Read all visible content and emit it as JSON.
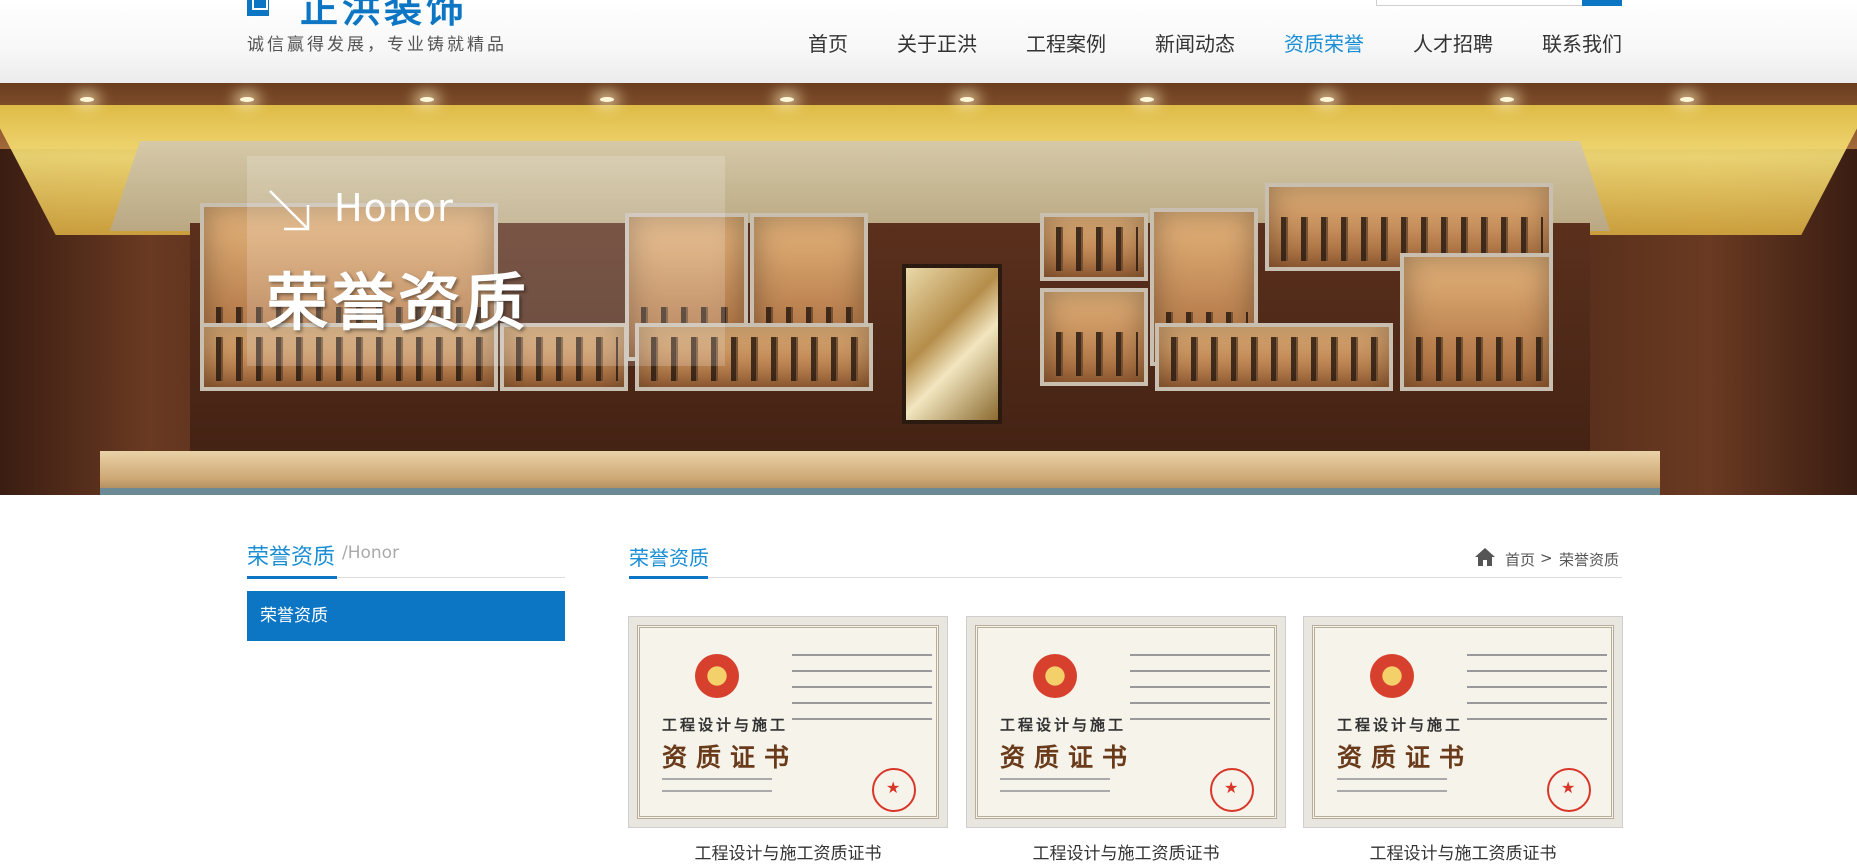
{
  "header": {
    "logo_name": "正洪装饰",
    "slogan": "诚信赢得发展，专业铸就精品"
  },
  "nav": {
    "items": [
      {
        "label": "首页"
      },
      {
        "label": "关于正洪"
      },
      {
        "label": "工程案例"
      },
      {
        "label": "新闻动态"
      },
      {
        "label": "资质荣誉"
      },
      {
        "label": "人才招聘"
      },
      {
        "label": "联系我们"
      }
    ],
    "active_index": 4
  },
  "banner": {
    "en": "Honor",
    "cn": "荣誉资质"
  },
  "sidebar": {
    "title": "荣誉资质",
    "subtitle": "/Honor",
    "items": [
      {
        "label": "荣誉资质"
      }
    ]
  },
  "main": {
    "title": "荣誉资质",
    "breadcrumb": {
      "home": "首页",
      "separator": ">",
      "current": "荣誉资质"
    },
    "certificates": [
      {
        "header_line": "工程设计与施工",
        "title_line": "资质证书",
        "caption": "工程设计与施工资质证书"
      },
      {
        "header_line": "工程设计与施工",
        "title_line": "资质证书",
        "caption": "工程设计与施工资质证书"
      },
      {
        "header_line": "工程设计与施工",
        "title_line": "资质证书",
        "caption": "工程设计与施工资质证书"
      }
    ]
  },
  "colors": {
    "accent": "#0c76c4",
    "accent_text": "#1a8ed4"
  }
}
